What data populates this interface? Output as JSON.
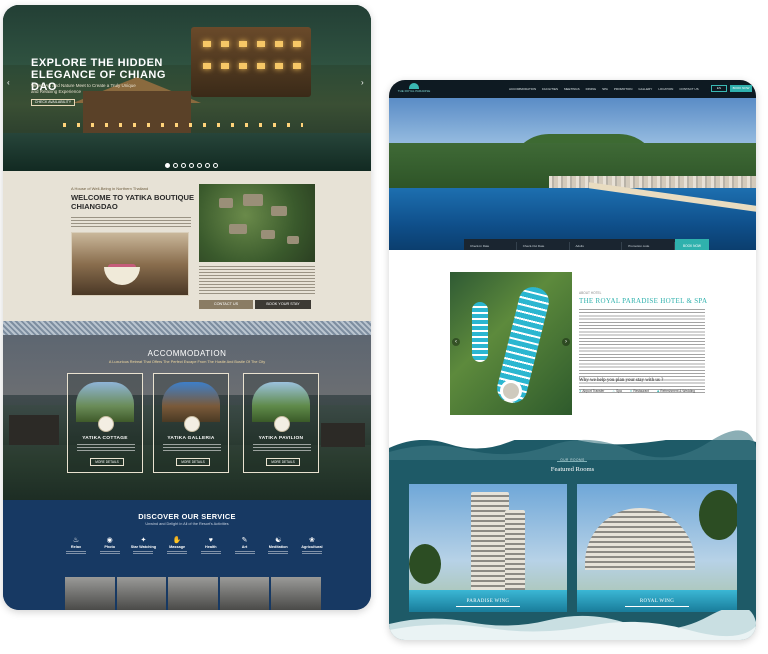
{
  "left": {
    "hero": {
      "title": "EXPLORE THE HIDDEN ELEGANCE OF CHIANG DAO",
      "subtitle": "Where Art and Nature Meet to Create a Truly Unique and Relaxing Experience",
      "button": "CHECK AVAILABILITY",
      "prev_icon": "‹",
      "next_icon": "›"
    },
    "welcome": {
      "kicker": "A House of Well-Being in Northern Thailand",
      "title": "WELCOME TO YATIKA BOUTIQUE CHIANGDAO",
      "contact_button": "CONTACT US",
      "book_button": "BOOK YOUR STAY"
    },
    "accommodation": {
      "title": "ACCOMMODATION",
      "subtitle": "A Luxurious Retreat That Offers The Perfect Escape From The Hustle And Bustle Of The City",
      "cards": [
        {
          "name": "YATIKA COTTAGE",
          "button": "MORE DETAILS"
        },
        {
          "name": "YATIKA GALLERIA",
          "button": "MORE DETAILS"
        },
        {
          "name": "YATIKA PAVILION",
          "button": "MORE DETAILS"
        }
      ]
    },
    "discover": {
      "title": "DISCOVER OUR SERVICE",
      "subtitle": "Unwind and Delight in All of the Resort's Activities",
      "services": [
        {
          "icon": "♨",
          "label": "Relax"
        },
        {
          "icon": "◉",
          "label": "Photo"
        },
        {
          "icon": "✦",
          "label": "Star Watching"
        },
        {
          "icon": "✋",
          "label": "Massage"
        },
        {
          "icon": "♥",
          "label": "Health"
        },
        {
          "icon": "✎",
          "label": "Art"
        },
        {
          "icon": "☯",
          "label": "Meditation"
        },
        {
          "icon": "❀",
          "label": "Agricultural"
        }
      ]
    }
  },
  "right": {
    "nav": {
      "logo": "THE ROYAL PARADISE",
      "links": [
        "ACCOMMODATION",
        "FACILITIES",
        "MEETINGS",
        "DINING",
        "SPA",
        "PROMOTION",
        "GALLERY",
        "LOCATION",
        "CONTACT US"
      ],
      "lang": "EN",
      "book": "BOOK NOW"
    },
    "booking": {
      "fields": [
        "Check-In Date",
        "Check-Out Date",
        "Adults",
        "Promotion code"
      ],
      "button": "BOOK NOW"
    },
    "about": {
      "kicker": "ABOUT HOTEL",
      "title": "THE ROYAL PARADISE HOTEL & SPA",
      "question": "Why we help you plan your stay with us ?",
      "features": [
        {
          "icon": "✈",
          "label": "Airport Transfer"
        },
        {
          "icon": "♨",
          "label": "Spa"
        },
        {
          "icon": "✕",
          "label": "Restaurant"
        },
        {
          "icon": "◆",
          "label": "Refreshment & Wedding"
        }
      ]
    },
    "rooms": {
      "kicker": "OUR ROOMS",
      "title": "Featured Rooms",
      "items": [
        {
          "caption": "PARADISE WING"
        },
        {
          "caption": "ROYAL WING"
        }
      ]
    }
  },
  "colors": {
    "teal": "#2fb1ad",
    "navy": "#173963",
    "beige": "#e7e2d6"
  }
}
